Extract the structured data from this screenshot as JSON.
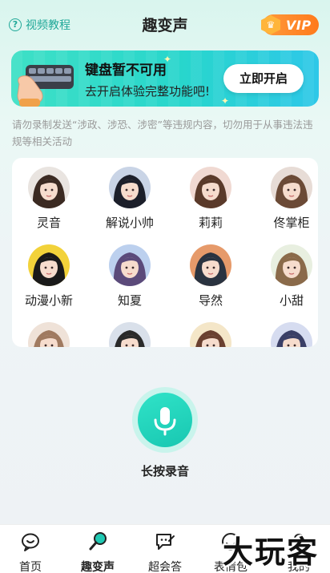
{
  "header": {
    "tutorial_label": "视频教程",
    "title": "趣变声",
    "vip_label": "VIP"
  },
  "banner": {
    "title": "键盘暂不可用",
    "subtitle": "去开启体验完整功能吧!",
    "button_label": "立即开启"
  },
  "notice": "请勿录制发送“涉政、涉恐、涉密”等违规内容，切勿用于从事违法违规等相关活动",
  "voices": [
    {
      "name": "灵音",
      "hair": "#3b2a22",
      "bg": "#e9e4e0"
    },
    {
      "name": "解说小帅",
      "hair": "#1c1f2a",
      "bg": "#c9d4e6"
    },
    {
      "name": "莉莉",
      "hair": "#5a3a2a",
      "bg": "#f0d9d2"
    },
    {
      "name": "佟掌柜",
      "hair": "#6b4a36",
      "bg": "#e7dcd6"
    },
    {
      "name": "动漫小新",
      "hair": "#1a1a1a",
      "bg": "#f2d23a"
    },
    {
      "name": "知夏",
      "hair": "#5b4a7a",
      "bg": "#bcd0ee"
    },
    {
      "name": "导然",
      "hair": "#2a3340",
      "bg": "#e69a6a"
    },
    {
      "name": "小甜",
      "hair": "#8a6a4a",
      "bg": "#e8efe0"
    },
    {
      "name": "",
      "hair": "#a07a60",
      "bg": "#efe2d8"
    },
    {
      "name": "",
      "hair": "#2a2a2a",
      "bg": "#d9e0ea"
    },
    {
      "name": "",
      "hair": "#6a4030",
      "bg": "#f4e6c8"
    },
    {
      "name": "",
      "hair": "#3a3f66",
      "bg": "#d6dcf0"
    }
  ],
  "record": {
    "label": "长按录音"
  },
  "nav": [
    {
      "label": "首页",
      "icon": "chat-bubble-icon"
    },
    {
      "label": "趣变声",
      "icon": "microphone-icon"
    },
    {
      "label": "超会答",
      "icon": "message-edit-icon"
    },
    {
      "label": "表情包",
      "icon": "smile-icon"
    },
    {
      "label": "我的",
      "icon": "person-icon"
    }
  ],
  "watermark": "大玩客",
  "colors": {
    "accent": "#1fc9b3",
    "vip": "#ff8a2a",
    "banner": "#2fd9c8"
  }
}
